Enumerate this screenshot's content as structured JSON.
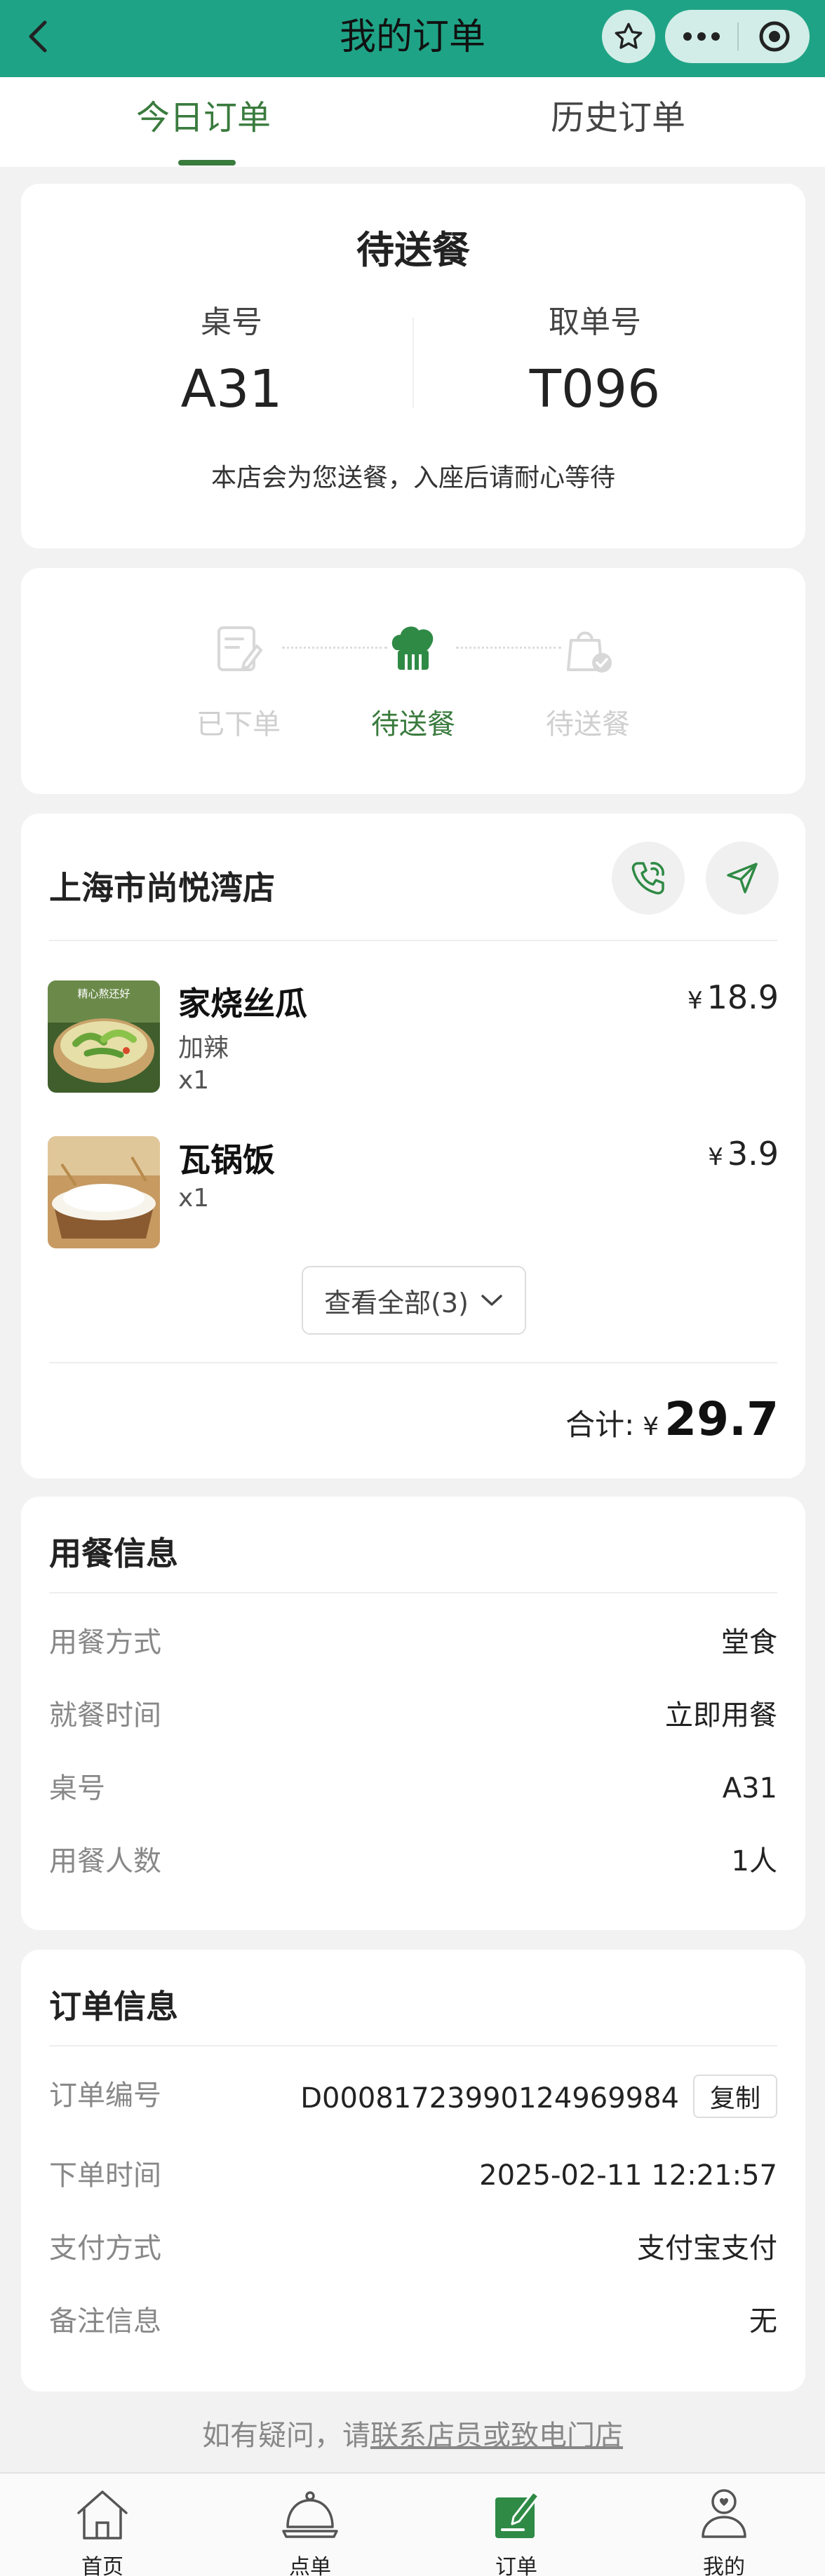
{
  "header": {
    "title": "我的订单"
  },
  "tabs": [
    {
      "label": "今日订单"
    },
    {
      "label": "历史订单"
    }
  ],
  "status": {
    "title": "待送餐",
    "table_label": "桌号",
    "table_value": "A31",
    "pickup_label": "取单号",
    "pickup_value": "T096",
    "notice": "本店会为您送餐，入座后请耐心等待"
  },
  "progress": [
    {
      "label": "已下单",
      "state": "done"
    },
    {
      "label": "待送餐",
      "state": "current"
    },
    {
      "label": "待送餐",
      "state": "pending"
    }
  ],
  "order": {
    "store_name": "上海市尚悦湾店",
    "items": [
      {
        "name": "家烧丝瓜",
        "option": "加辣",
        "qty": "x1",
        "currency": "¥",
        "price": "18.9",
        "image_text": "精心熬还好"
      },
      {
        "name": "瓦锅饭",
        "option": "",
        "qty": "x1",
        "currency": "¥",
        "price": "3.9"
      }
    ],
    "view_all_label": "查看全部(3)",
    "total_label": "合计:",
    "total_currency": "¥",
    "total_amount": "29.7"
  },
  "dining_info": {
    "title": "用餐信息",
    "rows": [
      {
        "key": "用餐方式",
        "value": "堂食"
      },
      {
        "key": "就餐时间",
        "value": "立即用餐"
      },
      {
        "key": "桌号",
        "value": "A31"
      },
      {
        "key": "用餐人数",
        "value": "1人"
      }
    ]
  },
  "order_info": {
    "title": "订单信息",
    "copy_label": "复制",
    "rows": [
      {
        "key": "订单编号",
        "value": "D0008172399012496998​4"
      },
      {
        "key": "下单时间",
        "value": "2025-02-11 12:21:57"
      },
      {
        "key": "支付方式",
        "value": "支付宝支付"
      },
      {
        "key": "备注信息",
        "value": "无"
      }
    ]
  },
  "footer": {
    "prefix": "如有疑问，请",
    "link": "联系店员或致电门店"
  },
  "bottom_nav": [
    {
      "label": "首页"
    },
    {
      "label": "点单"
    },
    {
      "label": "订单"
    },
    {
      "label": "我的"
    }
  ],
  "colors": {
    "header": "#1fa386",
    "accent": "#3a7b3e",
    "background": "#f2f2f2"
  }
}
